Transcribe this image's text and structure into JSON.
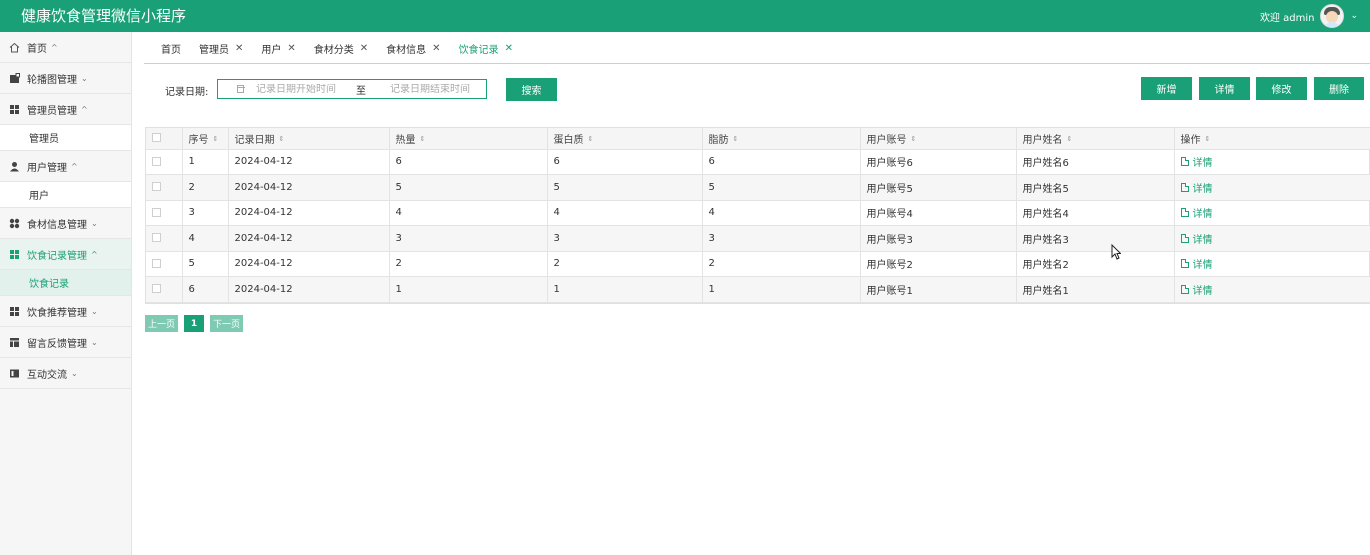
{
  "header": {
    "title": "健康饮食管理微信小程序",
    "welcome": "欢迎 admin",
    "brand_color": "#1aa076"
  },
  "sidebar": {
    "items": [
      {
        "label": "首页",
        "icon": "home-icon",
        "arrow": "^"
      },
      {
        "label": "轮播图管理",
        "icon": "image-icon",
        "arrow": "v"
      },
      {
        "label": "管理员管理",
        "icon": "grid-icon",
        "arrow": "^"
      },
      {
        "label": "管理员",
        "sub": true
      },
      {
        "label": "用户管理",
        "icon": "user-icon",
        "arrow": "^"
      },
      {
        "label": "用户",
        "sub": true
      },
      {
        "label": "食材信息管理",
        "icon": "apps-icon",
        "arrow": "v"
      },
      {
        "label": "饮食记录管理",
        "icon": "grid-icon",
        "arrow": "^",
        "active": true
      },
      {
        "label": "饮食记录",
        "sub": true,
        "active": true
      },
      {
        "label": "饮食推荐管理",
        "icon": "grid-icon",
        "arrow": "v"
      },
      {
        "label": "留言反馈管理",
        "icon": "table-icon",
        "arrow": "v"
      },
      {
        "label": "互动交流",
        "icon": "book-icon",
        "arrow": "v"
      }
    ]
  },
  "tabs": [
    {
      "label": "首页",
      "closable": false
    },
    {
      "label": "管理员",
      "closable": true
    },
    {
      "label": "用户",
      "closable": true
    },
    {
      "label": "食材分类",
      "closable": true
    },
    {
      "label": "食材信息",
      "closable": true
    },
    {
      "label": "饮食记录",
      "closable": true,
      "current": true
    }
  ],
  "filter": {
    "label": "记录日期:",
    "start_placeholder": "记录日期开始时间",
    "separator": "至",
    "end_placeholder": "记录日期结束时间",
    "search_label": "搜索"
  },
  "actions": {
    "add": "新增",
    "detail": "详情",
    "edit": "修改",
    "delete": "删除"
  },
  "table": {
    "columns": [
      "序号",
      "记录日期",
      "热量",
      "蛋白质",
      "脂肪",
      "用户账号",
      "用户姓名",
      "操作"
    ],
    "rows": [
      {
        "no": "1",
        "date": "2024-04-12",
        "calories": "6",
        "protein": "6",
        "fat": "6",
        "account": "用户账号6",
        "name": "用户姓名6"
      },
      {
        "no": "2",
        "date": "2024-04-12",
        "calories": "5",
        "protein": "5",
        "fat": "5",
        "account": "用户账号5",
        "name": "用户姓名5"
      },
      {
        "no": "3",
        "date": "2024-04-12",
        "calories": "4",
        "protein": "4",
        "fat": "4",
        "account": "用户账号4",
        "name": "用户姓名4"
      },
      {
        "no": "4",
        "date": "2024-04-12",
        "calories": "3",
        "protein": "3",
        "fat": "3",
        "account": "用户账号3",
        "name": "用户姓名3"
      },
      {
        "no": "5",
        "date": "2024-04-12",
        "calories": "2",
        "protein": "2",
        "fat": "2",
        "account": "用户账号2",
        "name": "用户姓名2"
      },
      {
        "no": "6",
        "date": "2024-04-12",
        "calories": "1",
        "protein": "1",
        "fat": "1",
        "account": "用户账号1",
        "name": "用户姓名1"
      }
    ],
    "row_action": "详情"
  },
  "pagination": {
    "prev": "上一页",
    "current": "1",
    "next": "下一页"
  }
}
